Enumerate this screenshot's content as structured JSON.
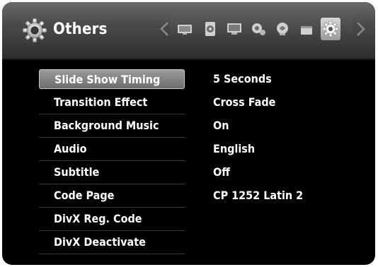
{
  "header": {
    "title": "Others",
    "icon": "gear-icon"
  },
  "tabs": [
    {
      "icon": "display-icon"
    },
    {
      "icon": "speaker-icon"
    },
    {
      "icon": "language-icon"
    },
    {
      "icon": "network-icon"
    },
    {
      "icon": "audio-icon"
    },
    {
      "icon": "lock-icon"
    },
    {
      "icon": "gear-icon",
      "active": true
    }
  ],
  "settings": [
    {
      "label": "Slide Show Timing",
      "value": "5 Seconds",
      "selected": true
    },
    {
      "label": "Transition Effect",
      "value": "Cross Fade"
    },
    {
      "label": "Background Music",
      "value": "On"
    },
    {
      "label": "Audio",
      "value": "English"
    },
    {
      "label": "Subtitle",
      "value": "Off"
    },
    {
      "label": "Code Page",
      "value": "CP 1252 Latin 2"
    },
    {
      "label": "DivX Reg. Code",
      "value": ""
    },
    {
      "label": "DivX Deactivate",
      "value": ""
    }
  ],
  "colors": {
    "background": "#000000",
    "text": "#ffffff",
    "selection": "#8a8a8a"
  }
}
